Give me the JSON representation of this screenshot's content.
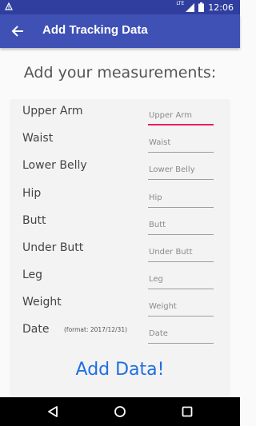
{
  "status_bar": {
    "time": "12:06",
    "network_label": "LTE",
    "icons": [
      "notification-icon",
      "signal-icon",
      "battery-icon"
    ]
  },
  "app_bar": {
    "title": "Add Tracking Data",
    "back_icon": "arrow-left-icon"
  },
  "form": {
    "heading": "Add your measurements:",
    "fields": [
      {
        "label": "Upper Arm",
        "placeholder": "Upper Arm",
        "value": ""
      },
      {
        "label": "Waist",
        "placeholder": "Waist",
        "value": ""
      },
      {
        "label": "Lower Belly",
        "placeholder": "Lower Belly",
        "value": ""
      },
      {
        "label": "Hip",
        "placeholder": "Hip",
        "value": ""
      },
      {
        "label": "Butt",
        "placeholder": "Butt",
        "value": ""
      },
      {
        "label": "Under Butt",
        "placeholder": "Under Butt",
        "value": ""
      },
      {
        "label": "Leg",
        "placeholder": "Leg",
        "value": ""
      },
      {
        "label": "Weight",
        "placeholder": "Weight",
        "value": ""
      },
      {
        "label": "Date",
        "placeholder": "Date",
        "value": "",
        "hint": "(format: 2017/12/31)"
      }
    ],
    "submit_label": "Add Data!"
  },
  "nav_bar": {
    "icons": [
      "back-triangle-icon",
      "home-circle-icon",
      "recents-square-icon"
    ]
  },
  "colors": {
    "status_bar": "#303f9f",
    "app_bar": "#3f51b5",
    "accent": "#e91e63",
    "button_text": "#1e6fe0"
  }
}
